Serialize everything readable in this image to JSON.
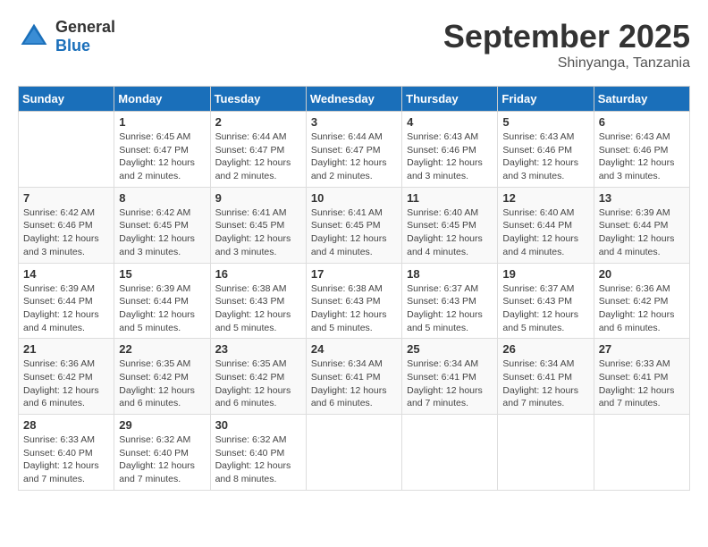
{
  "logo": {
    "general": "General",
    "blue": "Blue"
  },
  "title": "September 2025",
  "subtitle": "Shinyanga, Tanzania",
  "days_header": [
    "Sunday",
    "Monday",
    "Tuesday",
    "Wednesday",
    "Thursday",
    "Friday",
    "Saturday"
  ],
  "weeks": [
    [
      {
        "num": "",
        "info": ""
      },
      {
        "num": "1",
        "info": "Sunrise: 6:45 AM\nSunset: 6:47 PM\nDaylight: 12 hours\nand 2 minutes."
      },
      {
        "num": "2",
        "info": "Sunrise: 6:44 AM\nSunset: 6:47 PM\nDaylight: 12 hours\nand 2 minutes."
      },
      {
        "num": "3",
        "info": "Sunrise: 6:44 AM\nSunset: 6:47 PM\nDaylight: 12 hours\nand 2 minutes."
      },
      {
        "num": "4",
        "info": "Sunrise: 6:43 AM\nSunset: 6:46 PM\nDaylight: 12 hours\nand 3 minutes."
      },
      {
        "num": "5",
        "info": "Sunrise: 6:43 AM\nSunset: 6:46 PM\nDaylight: 12 hours\nand 3 minutes."
      },
      {
        "num": "6",
        "info": "Sunrise: 6:43 AM\nSunset: 6:46 PM\nDaylight: 12 hours\nand 3 minutes."
      }
    ],
    [
      {
        "num": "7",
        "info": "Sunrise: 6:42 AM\nSunset: 6:46 PM\nDaylight: 12 hours\nand 3 minutes."
      },
      {
        "num": "8",
        "info": "Sunrise: 6:42 AM\nSunset: 6:45 PM\nDaylight: 12 hours\nand 3 minutes."
      },
      {
        "num": "9",
        "info": "Sunrise: 6:41 AM\nSunset: 6:45 PM\nDaylight: 12 hours\nand 3 minutes."
      },
      {
        "num": "10",
        "info": "Sunrise: 6:41 AM\nSunset: 6:45 PM\nDaylight: 12 hours\nand 4 minutes."
      },
      {
        "num": "11",
        "info": "Sunrise: 6:40 AM\nSunset: 6:45 PM\nDaylight: 12 hours\nand 4 minutes."
      },
      {
        "num": "12",
        "info": "Sunrise: 6:40 AM\nSunset: 6:44 PM\nDaylight: 12 hours\nand 4 minutes."
      },
      {
        "num": "13",
        "info": "Sunrise: 6:39 AM\nSunset: 6:44 PM\nDaylight: 12 hours\nand 4 minutes."
      }
    ],
    [
      {
        "num": "14",
        "info": "Sunrise: 6:39 AM\nSunset: 6:44 PM\nDaylight: 12 hours\nand 4 minutes."
      },
      {
        "num": "15",
        "info": "Sunrise: 6:39 AM\nSunset: 6:44 PM\nDaylight: 12 hours\nand 5 minutes."
      },
      {
        "num": "16",
        "info": "Sunrise: 6:38 AM\nSunset: 6:43 PM\nDaylight: 12 hours\nand 5 minutes."
      },
      {
        "num": "17",
        "info": "Sunrise: 6:38 AM\nSunset: 6:43 PM\nDaylight: 12 hours\nand 5 minutes."
      },
      {
        "num": "18",
        "info": "Sunrise: 6:37 AM\nSunset: 6:43 PM\nDaylight: 12 hours\nand 5 minutes."
      },
      {
        "num": "19",
        "info": "Sunrise: 6:37 AM\nSunset: 6:43 PM\nDaylight: 12 hours\nand 5 minutes."
      },
      {
        "num": "20",
        "info": "Sunrise: 6:36 AM\nSunset: 6:42 PM\nDaylight: 12 hours\nand 6 minutes."
      }
    ],
    [
      {
        "num": "21",
        "info": "Sunrise: 6:36 AM\nSunset: 6:42 PM\nDaylight: 12 hours\nand 6 minutes."
      },
      {
        "num": "22",
        "info": "Sunrise: 6:35 AM\nSunset: 6:42 PM\nDaylight: 12 hours\nand 6 minutes."
      },
      {
        "num": "23",
        "info": "Sunrise: 6:35 AM\nSunset: 6:42 PM\nDaylight: 12 hours\nand 6 minutes."
      },
      {
        "num": "24",
        "info": "Sunrise: 6:34 AM\nSunset: 6:41 PM\nDaylight: 12 hours\nand 6 minutes."
      },
      {
        "num": "25",
        "info": "Sunrise: 6:34 AM\nSunset: 6:41 PM\nDaylight: 12 hours\nand 7 minutes."
      },
      {
        "num": "26",
        "info": "Sunrise: 6:34 AM\nSunset: 6:41 PM\nDaylight: 12 hours\nand 7 minutes."
      },
      {
        "num": "27",
        "info": "Sunrise: 6:33 AM\nSunset: 6:41 PM\nDaylight: 12 hours\nand 7 minutes."
      }
    ],
    [
      {
        "num": "28",
        "info": "Sunrise: 6:33 AM\nSunset: 6:40 PM\nDaylight: 12 hours\nand 7 minutes."
      },
      {
        "num": "29",
        "info": "Sunrise: 6:32 AM\nSunset: 6:40 PM\nDaylight: 12 hours\nand 7 minutes."
      },
      {
        "num": "30",
        "info": "Sunrise: 6:32 AM\nSunset: 6:40 PM\nDaylight: 12 hours\nand 8 minutes."
      },
      {
        "num": "",
        "info": ""
      },
      {
        "num": "",
        "info": ""
      },
      {
        "num": "",
        "info": ""
      },
      {
        "num": "",
        "info": ""
      }
    ]
  ]
}
